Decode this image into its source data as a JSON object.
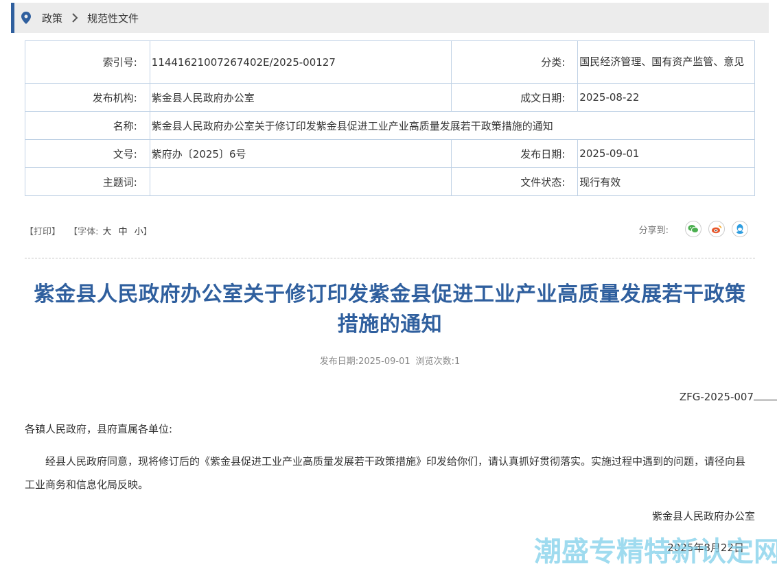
{
  "breadcrumb": {
    "items": [
      "政策",
      "规范性文件"
    ],
    "icons": {
      "location": "map-pin-icon",
      "separator": "chevron-right-icon"
    }
  },
  "meta": {
    "index_label": "索引号:",
    "index_value": "11441621007267402E/2025-00127",
    "category_label": "分类:",
    "category_value": "国民经济管理、国有资产监管、意见",
    "publisher_label": "发布机构:",
    "publisher_value": "紫金县人民政府办公室",
    "created_label": "成文日期:",
    "created_value": "2025-08-22",
    "name_label": "名称:",
    "name_value": "紫金县人民政府办公室关于修订印发紫金县促进工业产业高质量发展若干政策措施的通知",
    "docnum_label": "文号:",
    "docnum_value": "紫府办〔2025〕6号",
    "pubdate_label": "发布日期:",
    "pubdate_value": "2025-09-01",
    "subject_label": "主题词:",
    "subject_value": "",
    "status_label": "文件状态:",
    "status_value": "现行有效"
  },
  "toolbar": {
    "print": "【打印】",
    "font_label": "【字体:",
    "font_large": "大",
    "font_medium": "中",
    "font_small": "小",
    "font_close": "】",
    "share_label": "分享到:",
    "share_icons": [
      "wechat-icon",
      "weibo-icon",
      "qq-icon"
    ],
    "share_colors": {
      "wechat": "#4caf50",
      "weibo": "#e8562a",
      "qq": "#2d9de0"
    }
  },
  "article": {
    "title": "紫金县人民政府办公室关于修订印发紫金县促进工业产业高质量发展若干政策措施的通知",
    "pubdate": "发布日期:2025-09-01",
    "views": "浏览次数:1",
    "doc_code": "ZFG-2025-007",
    "addressee": "各镇人民政府，县府直属各单位:",
    "paragraph": "经县人民政府同意，现将修订后的《紫金县促进工业产业高质量发展若干政策措施》印发给你们，请认真抓好贯彻落实。实施过程中遇到的问题，请径向县工业商务和信息化局反映。",
    "signature": "紫金县人民政府办公室",
    "date": "2025年8月22日"
  },
  "watermark": "潮盛专精特新认定网",
  "colors": {
    "accent": "#2f5f9e",
    "table_border": "#bfd1e5",
    "breadcrumb_bg": "#ececec"
  }
}
